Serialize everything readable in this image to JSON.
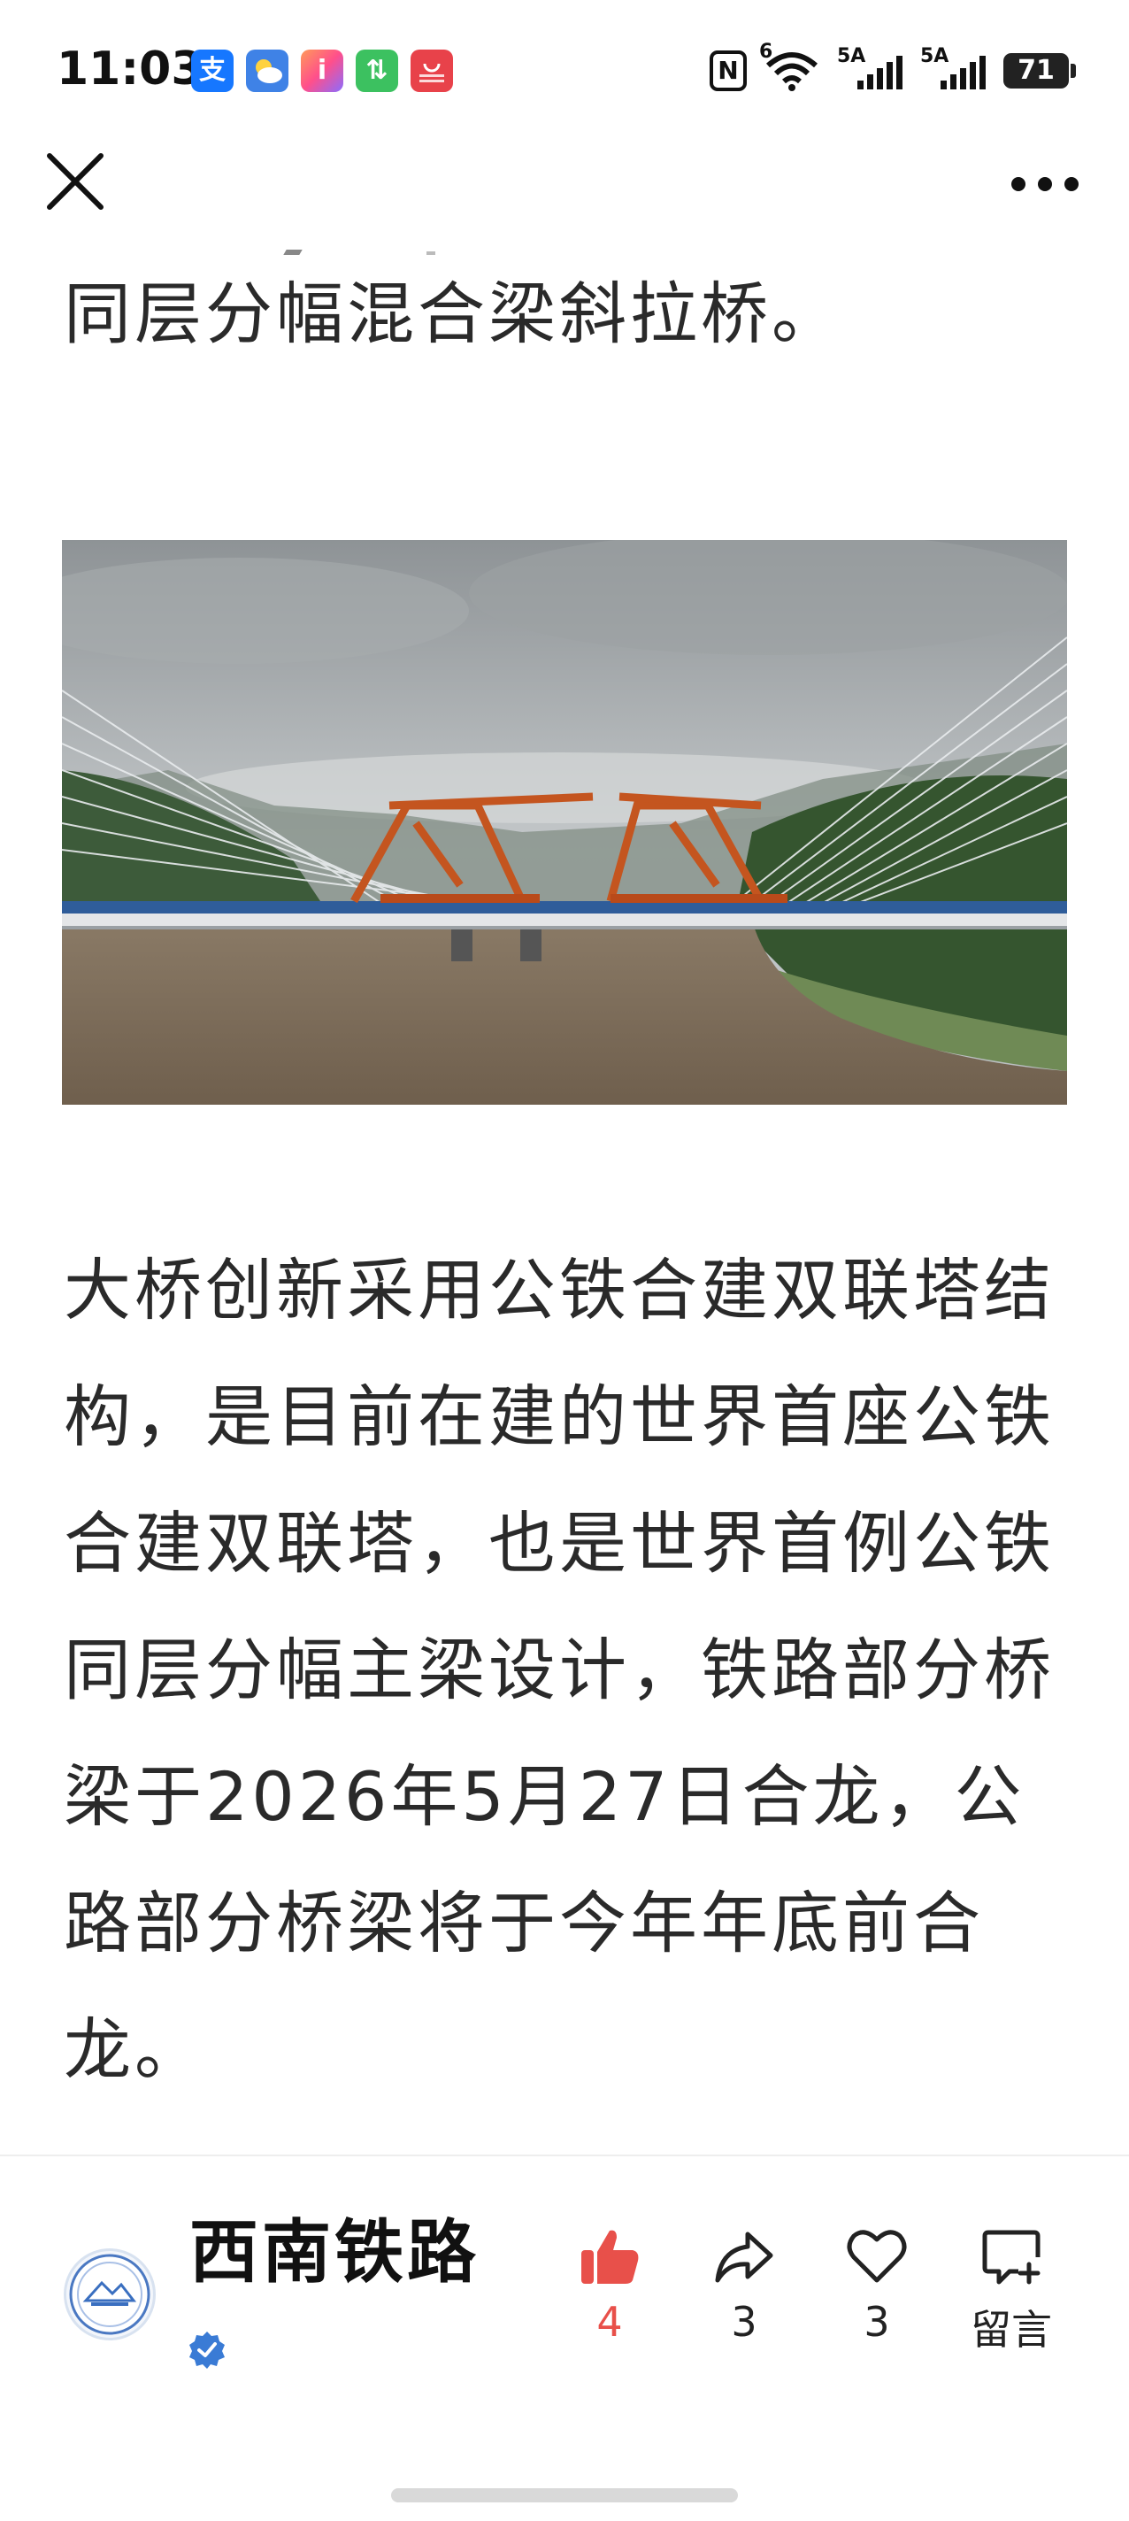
{
  "status_bar": {
    "time": "11:03",
    "app_icons": [
      {
        "name": "alipay-icon",
        "glyph": "支",
        "color": "#1677ff"
      },
      {
        "name": "weather-icon",
        "glyph": "",
        "color": "#4a90e2"
      },
      {
        "name": "app-i-icon",
        "glyph": "i",
        "color": "#ff5e7a"
      },
      {
        "name": "app-transfer-icon",
        "glyph": "⇅",
        "color": "#3cc160"
      },
      {
        "name": "app-gallery-icon",
        "glyph": "",
        "color": "#e8424a"
      }
    ],
    "nfc_label": "N",
    "wifi_badge": "6",
    "signal1_label": "5A",
    "signal2_label": "5A",
    "battery": "71"
  },
  "nav": {
    "close_icon": "close-icon",
    "more_icon": "more-horizontal-icon"
  },
  "article": {
    "paragraph1_tail": "同层分幅混合梁斜拉桥。",
    "image": "bridge-construction-photo",
    "paragraph2": "大桥创新采用公铁合建双联塔结构，是目前在建的世界首座公铁合建双联塔，也是世界首例公铁同层分幅主梁设计，铁路部分桥梁于2026年5月27日合龙，公路部分桥梁将于今年年底前合龙。"
  },
  "footer": {
    "account_name": "西南铁路",
    "verified": "verified-badge-icon",
    "actions": {
      "like_count": "4",
      "share_count": "3",
      "favorite_count": "3",
      "comment_label": "留言"
    }
  },
  "colors": {
    "like_accent": "#e8504a",
    "verified_blue": "#3a7bd5"
  }
}
